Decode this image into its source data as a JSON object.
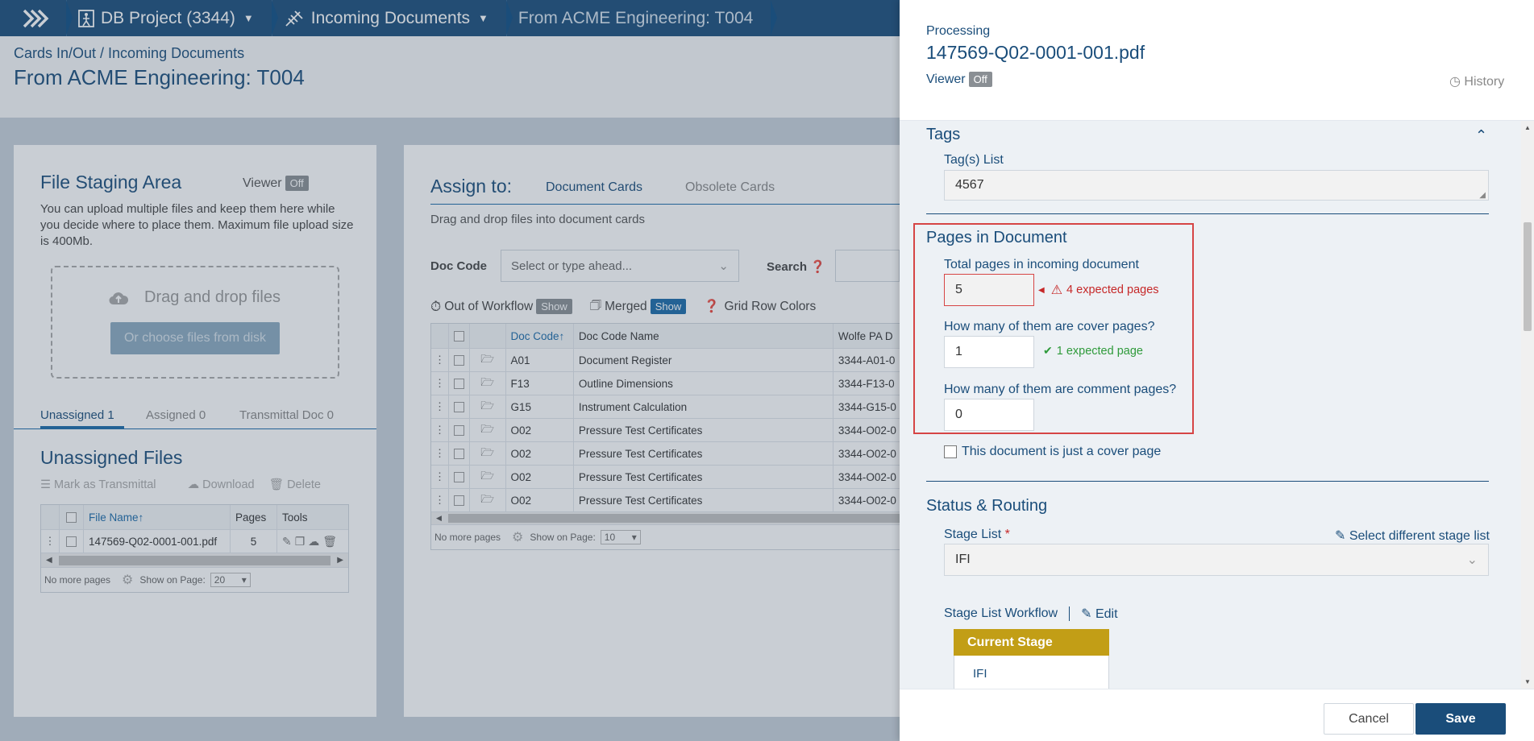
{
  "topbar": {
    "crumbs": [
      {
        "label": "DB Project (3344)"
      },
      {
        "label": "Incoming Documents"
      },
      {
        "label": "From ACME Engineering: T004"
      }
    ]
  },
  "pagehead": {
    "breadcrumb": "Cards In/Out / Incoming Documents",
    "title": "From ACME Engineering: T004"
  },
  "staging": {
    "title": "File Staging Area",
    "viewer_label": "Viewer",
    "viewer_state": "Off",
    "description": "You can upload multiple files and keep them here while you decide where to place them. Maximum file upload size is 400Mb.",
    "drop_text": "Drag and drop files",
    "choose_button": "Or choose files from disk",
    "tabs": [
      {
        "label": "Unassigned 1"
      },
      {
        "label": "Assigned 0"
      },
      {
        "label": "Transmittal Doc 0"
      }
    ],
    "list_title": "Unassigned Files",
    "actions": {
      "mark": "Mark as Transmittal",
      "download": "Download",
      "delete": "Delete"
    },
    "table": {
      "headers": {
        "file": "File Name",
        "pages": "Pages",
        "tools": "Tools"
      },
      "rows": [
        {
          "file": "147569-Q02-0001-001.pdf",
          "pages": "5"
        }
      ],
      "footer_no_more": "No more pages",
      "footer_show": "Show on Page:",
      "footer_count": "20"
    }
  },
  "assign": {
    "title": "Assign to:",
    "tabs": [
      {
        "label": "Document Cards"
      },
      {
        "label": "Obsolete Cards"
      }
    ],
    "hint": "Drag and drop files into document cards",
    "doc_code_label": "Doc Code",
    "doc_code_placeholder": "Select or type ahead...",
    "search_label": "Search",
    "filters": {
      "out_of_workflow": "Out of Workflow",
      "out_state": "Show",
      "merged": "Merged",
      "merged_state": "Show",
      "grid_colors": "Grid Row Colors"
    },
    "table": {
      "headers": {
        "code": "Doc Code",
        "name": "Doc Code Name",
        "pa": "Wolfe PA D"
      },
      "rows": [
        {
          "code": "A01",
          "name": "Document Register",
          "pa": "3344-A01-0"
        },
        {
          "code": "F13",
          "name": "Outline Dimensions",
          "pa": "3344-F13-0"
        },
        {
          "code": "G15",
          "name": "Instrument Calculation",
          "pa": "3344-G15-0"
        },
        {
          "code": "O02",
          "name": "Pressure Test Certificates",
          "pa": "3344-O02-0"
        },
        {
          "code": "O02",
          "name": "Pressure Test Certificates",
          "pa": "3344-O02-0"
        },
        {
          "code": "O02",
          "name": "Pressure Test Certificates",
          "pa": "3344-O02-0"
        },
        {
          "code": "O02",
          "name": "Pressure Test Certificates",
          "pa": "3344-O02-0"
        }
      ],
      "footer_no_more": "No more pages",
      "footer_show": "Show on Page:",
      "footer_count": "10"
    }
  },
  "panel": {
    "status": "Processing",
    "filename": "147569-Q02-0001-001.pdf",
    "viewer_label": "Viewer",
    "viewer_state": "Off",
    "history": "History",
    "tags": {
      "title": "Tags",
      "list_label": "Tag(s) List",
      "list_value": "4567"
    },
    "pages": {
      "title": "Pages in Document",
      "total_label": "Total pages in incoming document",
      "total_value": "5",
      "total_msg": "4 expected pages",
      "cover_label": "How many of them are cover pages?",
      "cover_value": "1",
      "cover_msg": "1 expected page",
      "comment_label": "How many of them are comment pages?",
      "comment_value": "0",
      "just_cover": "This document is just a cover page"
    },
    "routing": {
      "title": "Status & Routing",
      "stage_list_label": "Stage List",
      "required_mark": "*",
      "select_diff": "Select different stage list",
      "stage_value": "IFI",
      "workflow_label": "Stage List Workflow",
      "edit": "Edit",
      "current_stage": "Current Stage",
      "current_value": "IFI"
    },
    "footer": {
      "cancel": "Cancel",
      "save": "Save"
    }
  },
  "colors": {
    "brand": "#1a4d7a",
    "error": "#c62828",
    "success": "#2e9a3a",
    "stage": "#c29e16"
  }
}
